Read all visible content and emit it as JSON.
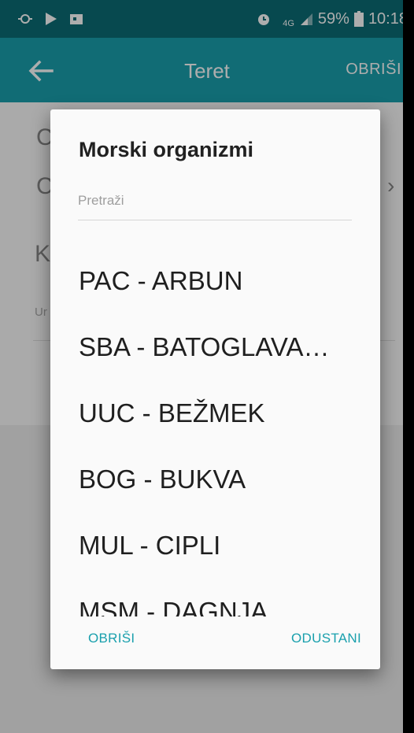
{
  "status_bar": {
    "network": "4G",
    "battery": "59%",
    "time": "10:18",
    "icons": [
      "activity-icon",
      "play-store-icon",
      "gallery-icon",
      "alarm-icon",
      "signal-icon",
      "battery-icon"
    ]
  },
  "app_bar": {
    "title": "Teret",
    "action": "OBRIŠI",
    "back_icon": "arrow-left-icon"
  },
  "background": {
    "row1_initial": "C",
    "row2_initial": "C",
    "row3_initial": "K",
    "row4_small": "Ur"
  },
  "dialog": {
    "title": "Morski organizmi",
    "search_placeholder": "Pretraži",
    "items": [
      "PAC - ARBUN",
      "SBA - BATOGLAVA…",
      "UUC - BEŽMEK",
      "BOG - BUKVA",
      "MUL - CIPLI",
      "MSM - DAGNJA"
    ],
    "btn_clear": "OBRIŠI",
    "btn_cancel": "ODUSTANI"
  },
  "colors": {
    "status_bar": "#0b6c75",
    "app_bar": "#1aa0ad",
    "accent": "#1aa0ad"
  }
}
